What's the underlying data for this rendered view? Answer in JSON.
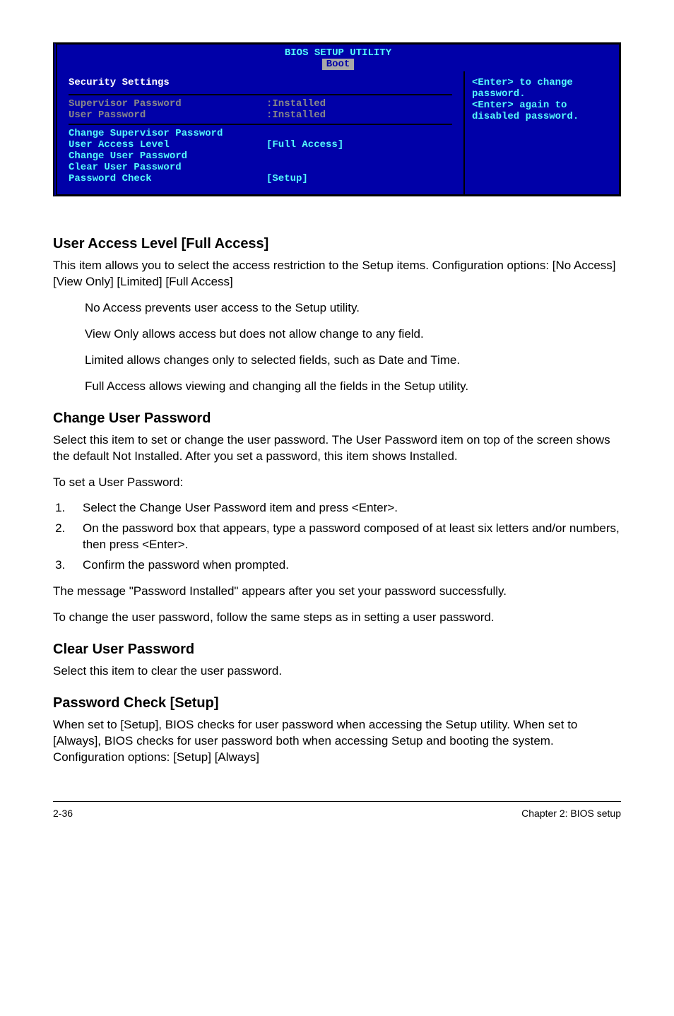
{
  "bios": {
    "header": "BIOS SETUP UTILITY",
    "tab": "Boot",
    "sectionTitle": "Security Settings",
    "supervisorLabel": "Supervisor Password",
    "supervisorValue": ":Installed",
    "userLabel": "User Password",
    "userValue": ":Installed",
    "changeSupervisor": "Change Supervisor Password",
    "userAccessLabel": "User Access Level",
    "userAccessValue": "[Full Access]",
    "changeUser": "Change User Password",
    "clearUser": "Clear User Password",
    "passwordCheckLabel": "Password Check",
    "passwordCheckValue": "[Setup]",
    "help1": "<Enter> to change password.",
    "help2": "<Enter> again to disabled password."
  },
  "s1": {
    "heading": "User Access Level [Full Access]",
    "p1": "This item allows you to select the access restriction to the Setup items. Configuration options: [No Access] [View Only] [Limited] [Full Access]",
    "noAccess": "No Access prevents user access to the Setup utility.",
    "viewOnly": "View Only allows access but does not allow change to any field.",
    "limited": "Limited allows changes only to selected fields, such as Date and Time.",
    "fullAccess": "Full Access allows viewing and changing all the fields in the Setup utility."
  },
  "s2": {
    "heading": "Change User Password",
    "p1": "Select this item to set or change the user password. The User Password item on top of the screen shows the default Not Installed. After you set a password, this item shows Installed.",
    "p2": "To set a User Password:",
    "li1": "Select the Change User Password item and press <Enter>.",
    "li2": "On the password box that appears, type a password composed of at least six letters and/or numbers, then press <Enter>.",
    "li3": "Confirm the password when prompted.",
    "p3": "The message \"Password Installed\" appears after you set your password successfully.",
    "p4": "To change the user password, follow the same steps as in setting a user password."
  },
  "s3": {
    "heading": "Clear User Password",
    "p1": "Select this item to clear the user password."
  },
  "s4": {
    "heading": "Password Check [Setup]",
    "p1": "When set to [Setup], BIOS checks for user password when accessing the Setup utility. When set to [Always], BIOS checks for user password both when accessing Setup and booting the system. Configuration options: [Setup] [Always]"
  },
  "footer": {
    "left": "2-36",
    "right": "Chapter 2: BIOS setup"
  }
}
